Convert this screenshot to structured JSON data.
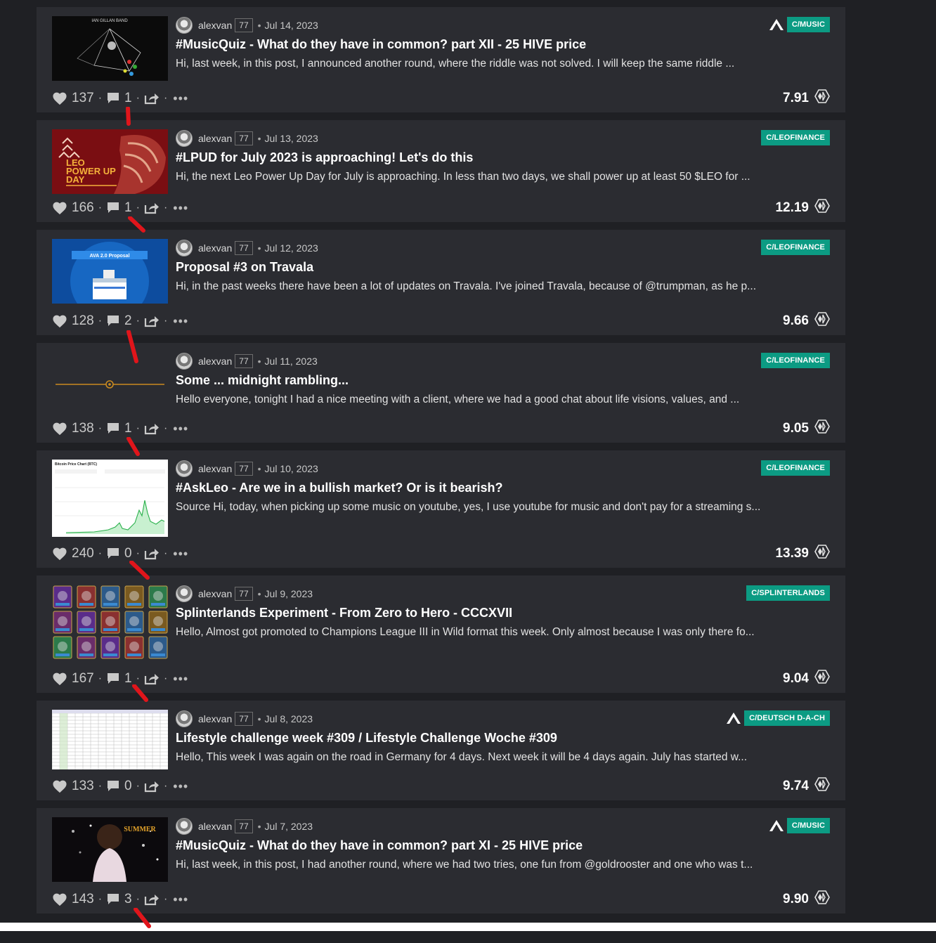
{
  "posts": [
    {
      "author": "alexvan",
      "reputation": "77",
      "date": "Jul 14, 2023",
      "community": "C/MUSIC",
      "has_hive_icon": true,
      "title": "#MusicQuiz - What do they have in common? part XII - 25 HIVE price",
      "excerpt": "Hi, last week, in this post, I announced another round, where the riddle was not solved. I will keep the same riddle ...",
      "votes": "137",
      "comments": "1",
      "payout": "7.91",
      "thumb_text": "IAN GILLAN BAND"
    },
    {
      "author": "alexvan",
      "reputation": "77",
      "date": "Jul 13, 2023",
      "community": "C/LEOFINANCE",
      "has_hive_icon": false,
      "title": "#LPUD for July 2023 is approaching! Let's do this",
      "excerpt": "Hi, the next Leo Power Up Day for July is approaching. In less than two days, we shall power up at least 50 $LEO for ...",
      "votes": "166",
      "comments": "1",
      "payout": "12.19",
      "thumb_text": "LEO POWER UP DAY"
    },
    {
      "author": "alexvan",
      "reputation": "77",
      "date": "Jul 12, 2023",
      "community": "C/LEOFINANCE",
      "has_hive_icon": false,
      "title": "Proposal #3 on Travala",
      "excerpt": "Hi, in the past weeks there have been a lot of updates on Travala. I've joined Travala, because of @trumpman, as he p...",
      "votes": "128",
      "comments": "2",
      "payout": "9.66",
      "thumb_text": "AVA 2.0 Proposal"
    },
    {
      "author": "alexvan",
      "reputation": "77",
      "date": "Jul 11, 2023",
      "community": "C/LEOFINANCE",
      "has_hive_icon": false,
      "title": "Some ... midnight rambling...",
      "excerpt": "Hello everyone, tonight I had a nice meeting with a client, where we had a good chat about life visions, values, and ...",
      "votes": "138",
      "comments": "1",
      "payout": "9.05",
      "thumb_text": ""
    },
    {
      "author": "alexvan",
      "reputation": "77",
      "date": "Jul 10, 2023",
      "community": "C/LEOFINANCE",
      "has_hive_icon": false,
      "title": "#AskLeo - Are we in a bullish market? Or is it bearish?",
      "excerpt": "Source Hi, today, when picking up some music on youtube, yes, I use youtube for music and don't pay for a streaming s...",
      "votes": "240",
      "comments": "0",
      "payout": "13.39",
      "thumb_text": "Bitcoin Price Chart (BTC)"
    },
    {
      "author": "alexvan",
      "reputation": "77",
      "date": "Jul 9, 2023",
      "community": "C/SPLINTERLANDS",
      "has_hive_icon": false,
      "title": "Splinterlands Experiment - From Zero to Hero - CCCXVII",
      "excerpt": "Hello, Almost got promoted to Champions League III in Wild format this week. Only almost because I was only there fo...",
      "votes": "167",
      "comments": "1",
      "payout": "9.04",
      "thumb_text": ""
    },
    {
      "author": "alexvan",
      "reputation": "77",
      "date": "Jul 8, 2023",
      "community": "C/DEUTSCH D-A-CH",
      "has_hive_icon": true,
      "title": "Lifestyle challenge week #309 / Lifestyle Challenge Woche #309",
      "excerpt": "Hello, This week I was again on the road in Germany for 4 days. Next week it will be 4 days again. July has started w...",
      "votes": "133",
      "comments": "0",
      "payout": "9.74",
      "thumb_text": ""
    },
    {
      "author": "alexvan",
      "reputation": "77",
      "date": "Jul 7, 2023",
      "community": "C/MUSIC",
      "has_hive_icon": true,
      "title": "#MusicQuiz - What do they have in common? part XI - 25 HIVE price",
      "excerpt": "Hi, last week, in this post, I had another round, where we had two tries, one fun from @goldrooster and one who was t...",
      "votes": "143",
      "comments": "3",
      "payout": "9.90",
      "thumb_text": "SUMMER"
    }
  ],
  "separator": "·",
  "more_label": "•••",
  "colors": {
    "background": "#1f2024",
    "card": "#2b2c31",
    "badge": "#0c9b83",
    "annotation": "#e0151b"
  }
}
